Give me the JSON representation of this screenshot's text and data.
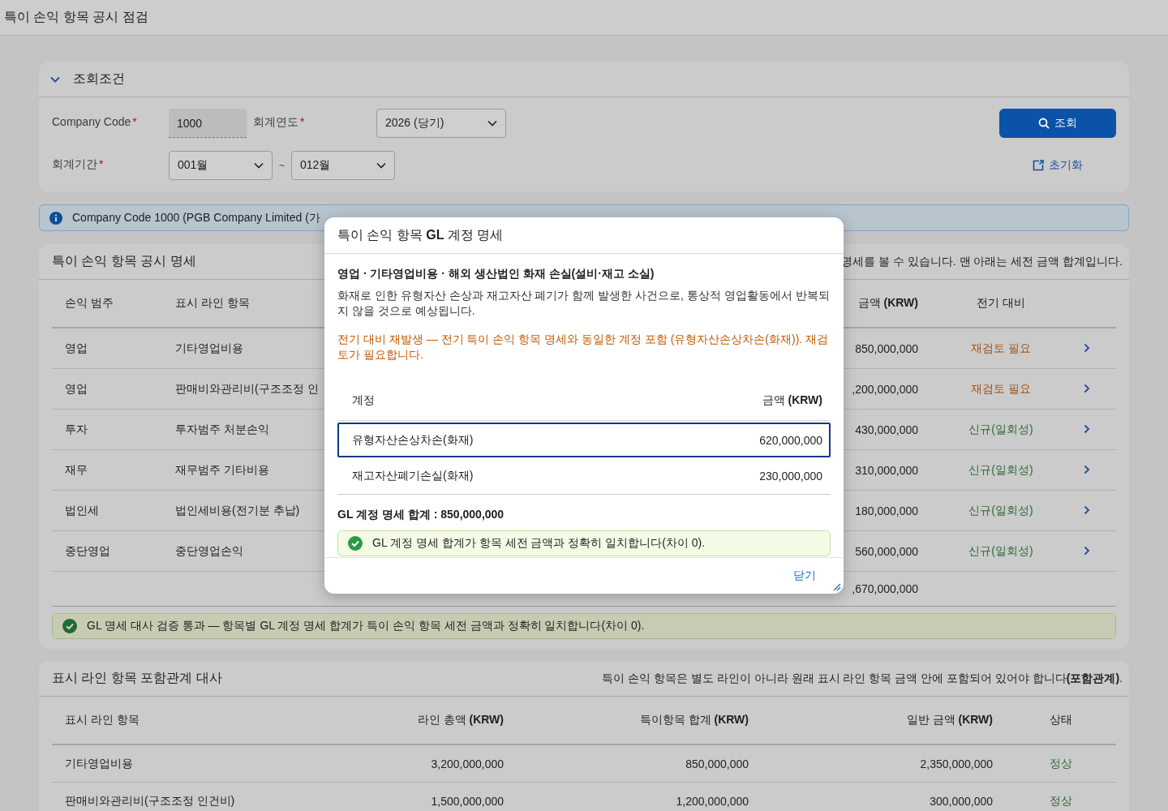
{
  "page_title": "특이 손익 항목 공시 점검",
  "filter": {
    "title": "조회조건",
    "expanded": true,
    "company_code": {
      "label": "Company Code",
      "required_mark": "*",
      "value": "1000",
      "readonly": true
    },
    "fiscal_year": {
      "label": "회계연도",
      "required_mark": "*",
      "value": "2026 (당기)"
    },
    "period": {
      "label": "회계기간",
      "required_mark": "*",
      "from": "001월",
      "separator": "~",
      "to": "012월"
    },
    "search_button": "조회",
    "reset_button": "초기화"
  },
  "info_banner": {
    "text": "Company Code 1000 (PGB Company Limited (가"
  },
  "items_section": {
    "title": "특이 손익 항목 공시 명세",
    "hint": "명세를 볼 수 있습니다. 맨 아래는 세전 금액 합계입니다.",
    "columns": [
      "손익 범주",
      "표시 라인 항목",
      "금액 **(KRW)**",
      "전기 대비"
    ],
    "rows": [
      {
        "category": "영업",
        "line_item": "기타영업비용",
        "amount": "850,000,000",
        "comparison": "재검토 필요",
        "kind": "review"
      },
      {
        "category": "영업",
        "line_item": "판매비와관리비(구조조정 인",
        "amount": ",200,000,000",
        "comparison": "재검토 필요",
        "kind": "review"
      },
      {
        "category": "투자",
        "line_item": "투자범주 처분손익",
        "amount": "430,000,000",
        "comparison": "신규(일회성)",
        "kind": "new"
      },
      {
        "category": "재무",
        "line_item": "재무범주 기타비용",
        "amount": "310,000,000",
        "comparison": "신규(일회성)",
        "kind": "new"
      },
      {
        "category": "법인세",
        "line_item": "법인세비용(전기분 추납)",
        "amount": "180,000,000",
        "comparison": "신규(일회성)",
        "kind": "new"
      },
      {
        "category": "중단영업",
        "line_item": "중단영업손익",
        "amount": "560,000,000",
        "comparison": "신규(일회성)",
        "kind": "new"
      }
    ],
    "total_amount": ",670,000,000",
    "validation": {
      "kind": "success",
      "text": "GL 명세 대사 검증 통과 — 항목별 GL 계정 명세 합계가 특이 손익 항목 세전 금액과 정확히 일치합니다(차이 0)."
    }
  },
  "reconciliation": {
    "title": "표시 라인 항목 포함관계 대사",
    "hint": "특이 손익 항목은 별도 라인이 아니라 원래 표시 라인 항목 금액 안에 포함되어 있어야 합니다**(포함관계)**.",
    "columns": [
      "표시 라인 항목",
      "라인 총액 **(KRW)**",
      "특이항목 합계 **(KRW)**",
      "일반 금액 **(KRW)**",
      "상태"
    ],
    "rows": [
      {
        "line_item": "기타영업비용",
        "total": "3,200,000,000",
        "special": "850,000,000",
        "normal": "2,350,000,000",
        "status": "정상",
        "kind": "ok"
      },
      {
        "line_item": "판매비와관리비(구조조정 인건비)",
        "total": "1,500,000,000",
        "special": "1,200,000,000",
        "normal": "300,000,000",
        "status": "정상",
        "kind": "ok"
      }
    ]
  },
  "modal": {
    "title": "특이 손익 항목 **GL** 계정 명세",
    "heading": "영업 · 기타영업비용 · 해외 생산법인 화재 손실(설비·재고 소실)",
    "description": "화재로 인한 유형자산 손상과 재고자산 폐기가 함께 발생한 사건으로, 통상적 영업활동에서 반복되지 않을 것으로 예상됩니다.",
    "warning": "전기 대비 재발생 — 전기 특이 손익 항목 명세와 동일한 계정 포함 (유형자산손상차손(화재)). 재검토가 필요합니다.",
    "columns": [
      "계정",
      "금액 **(KRW)**"
    ],
    "rows": [
      {
        "account": "유형자산손상차손(화재)",
        "amount": "620,000,000",
        "selected": true
      },
      {
        "account": "재고자산폐기손실(화재)",
        "amount": "230,000,000",
        "selected": false
      }
    ],
    "total": "GL 계정 명세 합계 : 850,000,000",
    "validation": {
      "kind": "success",
      "text": "GL 계정 명세 합계가 항목 세전 금액과 정확히 일치합니다(차이 0)."
    },
    "close_button": "닫기"
  }
}
